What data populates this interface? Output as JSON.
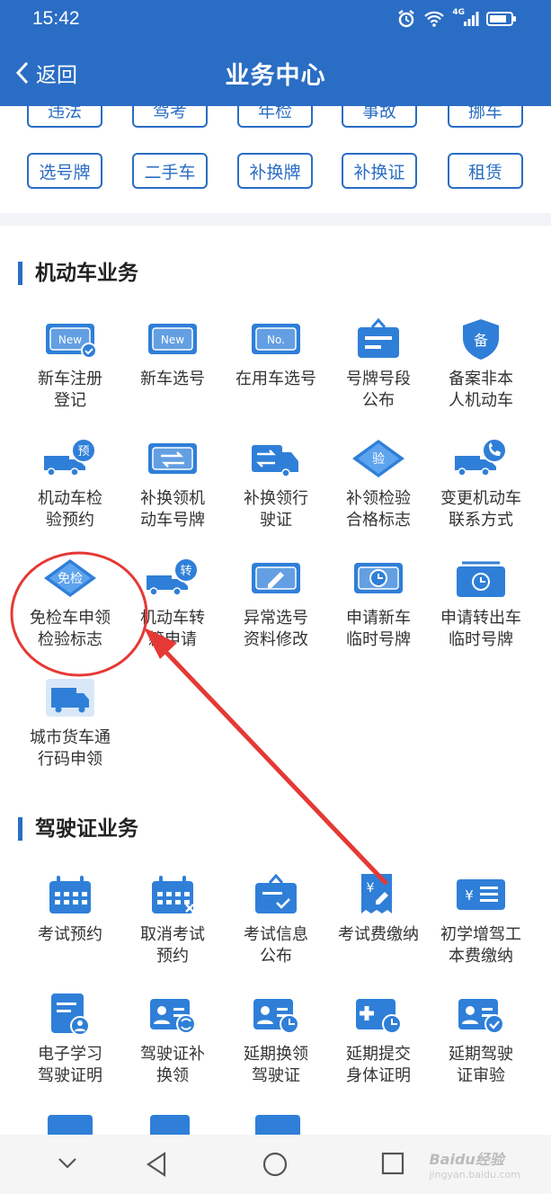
{
  "status": {
    "time": "15:42",
    "network": "4G"
  },
  "header": {
    "back_label": "返回",
    "title": "业务中心"
  },
  "tags_row1": [
    "违法",
    "驾考",
    "年检",
    "事故",
    "挪车"
  ],
  "tags_row2": [
    "选号牌",
    "二手车",
    "补换牌",
    "补换证",
    "租赁"
  ],
  "sections": {
    "vehicle": {
      "title": "机动车业务",
      "items": [
        {
          "label": "新车注册\n登记",
          "icon": "new-plate-check-icon",
          "badge": "New"
        },
        {
          "label": "新车选号",
          "icon": "new-plate-icon",
          "badge": "New"
        },
        {
          "label": "在用车选号",
          "icon": "number-plate-icon",
          "badge": "No."
        },
        {
          "label": "号牌号段\n公布",
          "icon": "notice-board-icon",
          "badge": ""
        },
        {
          "label": "备案非本\n人机动车",
          "icon": "shield-record-icon",
          "badge": "备"
        },
        {
          "label": "机动车检\n验预约",
          "icon": "truck-reserve-icon",
          "badge": "预"
        },
        {
          "label": "补换领机\n动车号牌",
          "icon": "plate-swap-icon",
          "badge": ""
        },
        {
          "label": "补换领行\n驶证",
          "icon": "license-swap-icon",
          "badge": ""
        },
        {
          "label": "补领检验\n合格标志",
          "icon": "inspection-diamond-icon",
          "badge": "验"
        },
        {
          "label": "变更机动车\n联系方式",
          "icon": "truck-phone-icon",
          "badge": ""
        },
        {
          "label": "免检车申领\n检验标志",
          "icon": "exempt-diamond-icon",
          "badge": "免检"
        },
        {
          "label": "机动车转\n籍申请",
          "icon": "truck-transfer-icon",
          "badge": "转"
        },
        {
          "label": "异常选号\n资料修改",
          "icon": "plate-edit-icon",
          "badge": ""
        },
        {
          "label": "申请新车\n临时号牌",
          "icon": "temp-plate-clock-icon",
          "badge": ""
        },
        {
          "label": "申请转出车\n临时号牌",
          "icon": "temp-plate-out-icon",
          "badge": ""
        },
        {
          "label": "城市货车通\n行码申领",
          "icon": "cargo-truck-icon",
          "badge": ""
        }
      ]
    },
    "license": {
      "title": "驾驶证业务",
      "items": [
        {
          "label": "考试预约",
          "icon": "calendar-icon",
          "badge": ""
        },
        {
          "label": "取消考试\n预约",
          "icon": "calendar-cancel-icon",
          "badge": ""
        },
        {
          "label": "考试信息\n公布",
          "icon": "notice-check-icon",
          "badge": ""
        },
        {
          "label": "考试费缴纳",
          "icon": "fee-receipt-icon",
          "badge": "¥"
        },
        {
          "label": "初学增驾工\n本费缴纳",
          "icon": "fee-card-icon",
          "badge": "¥"
        },
        {
          "label": "电子学习\n驾驶证明",
          "icon": "study-doc-icon",
          "badge": ""
        },
        {
          "label": "驾驶证补\n换领",
          "icon": "id-swap-icon",
          "badge": ""
        },
        {
          "label": "延期换领\n驾驶证",
          "icon": "id-clock-icon",
          "badge": ""
        },
        {
          "label": "延期提交\n身体证明",
          "icon": "medical-clock-icon",
          "badge": ""
        },
        {
          "label": "延期驾驶\n证审验",
          "icon": "id-check-icon",
          "badge": ""
        }
      ]
    }
  },
  "watermark": {
    "main": "Baidu经验",
    "sub": "jingyan.baidu.com"
  },
  "colors": {
    "primary": "#2a6dc4",
    "icon": "#2f7fd8",
    "annotation": "#e53935"
  }
}
